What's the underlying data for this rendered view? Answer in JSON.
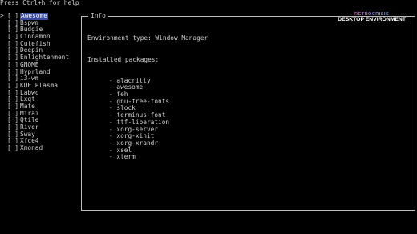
{
  "help_text": "Press Ctrl+h for help",
  "cursor_glyph": ">",
  "checkbox_empty": "[ ]",
  "selected_index": 0,
  "environments": [
    "Awesome",
    "Bspwm",
    "Budgie",
    "Cinnamon",
    "Cutefish",
    "Deepin",
    "Enlightenment",
    "GNOME",
    "Hyprland",
    "i3-wm",
    "KDE Plasma",
    "Labwc",
    "Lxqt",
    "Mate",
    "Mirai",
    "Qtile",
    "River",
    "Sway",
    "Xfce4",
    "Xmonad"
  ],
  "info": {
    "title": "Info",
    "env_type_line": "Environment type: Window Manager",
    "installed_label": "Installed packages:",
    "packages": [
      "alacritty",
      "awesome",
      "feh",
      "gnu-free-fonts",
      "slock",
      "terminus-font",
      "ttf-liberation",
      "xorg-server",
      "xorg-xinit",
      "xorg-xrandr",
      "xsel",
      "xterm"
    ]
  },
  "logo": {
    "top": "RETROCRISIS",
    "main": "DESKTOP ENVIRONMENT"
  },
  "colors": {
    "selected_bg": "#3a4a9c",
    "logo_gradient": [
      "#ff3ea5",
      "#2ec7ff"
    ]
  }
}
